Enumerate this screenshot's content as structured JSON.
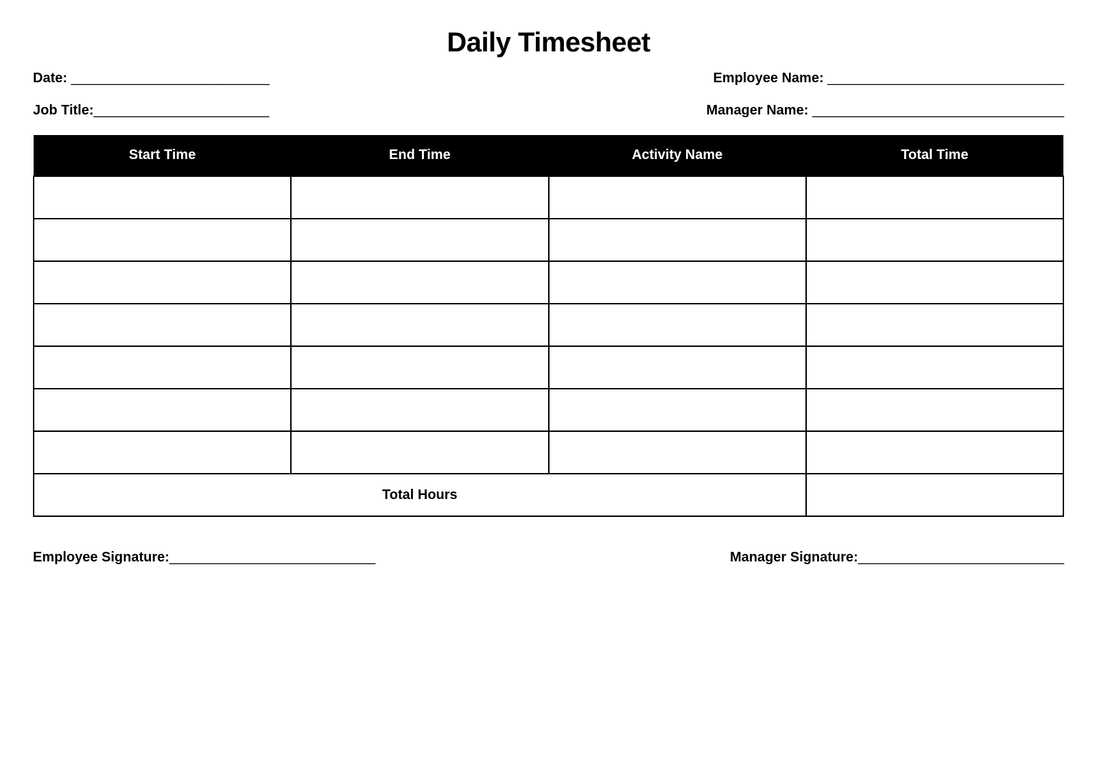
{
  "title": "Daily Timesheet",
  "fields": {
    "date_label": "Date:",
    "date_line": " __________________________",
    "employee_name_label": "Employee Name:",
    "employee_name_line": " _______________________________",
    "job_title_label": "Job Title:",
    "job_title_line": "_______________________",
    "manager_name_label": "Manager Name:",
    "manager_name_line": " _________________________________"
  },
  "table": {
    "headers": {
      "start_time": "Start Time",
      "end_time": "End Time",
      "activity_name": "Activity Name",
      "total_time": "Total Time"
    },
    "total_hours_label": "Total Hours"
  },
  "signatures": {
    "employee_label": "Employee Signature:",
    "employee_line": "___________________________",
    "manager_label": "Manager Signature:",
    "manager_line": "___________________________"
  }
}
